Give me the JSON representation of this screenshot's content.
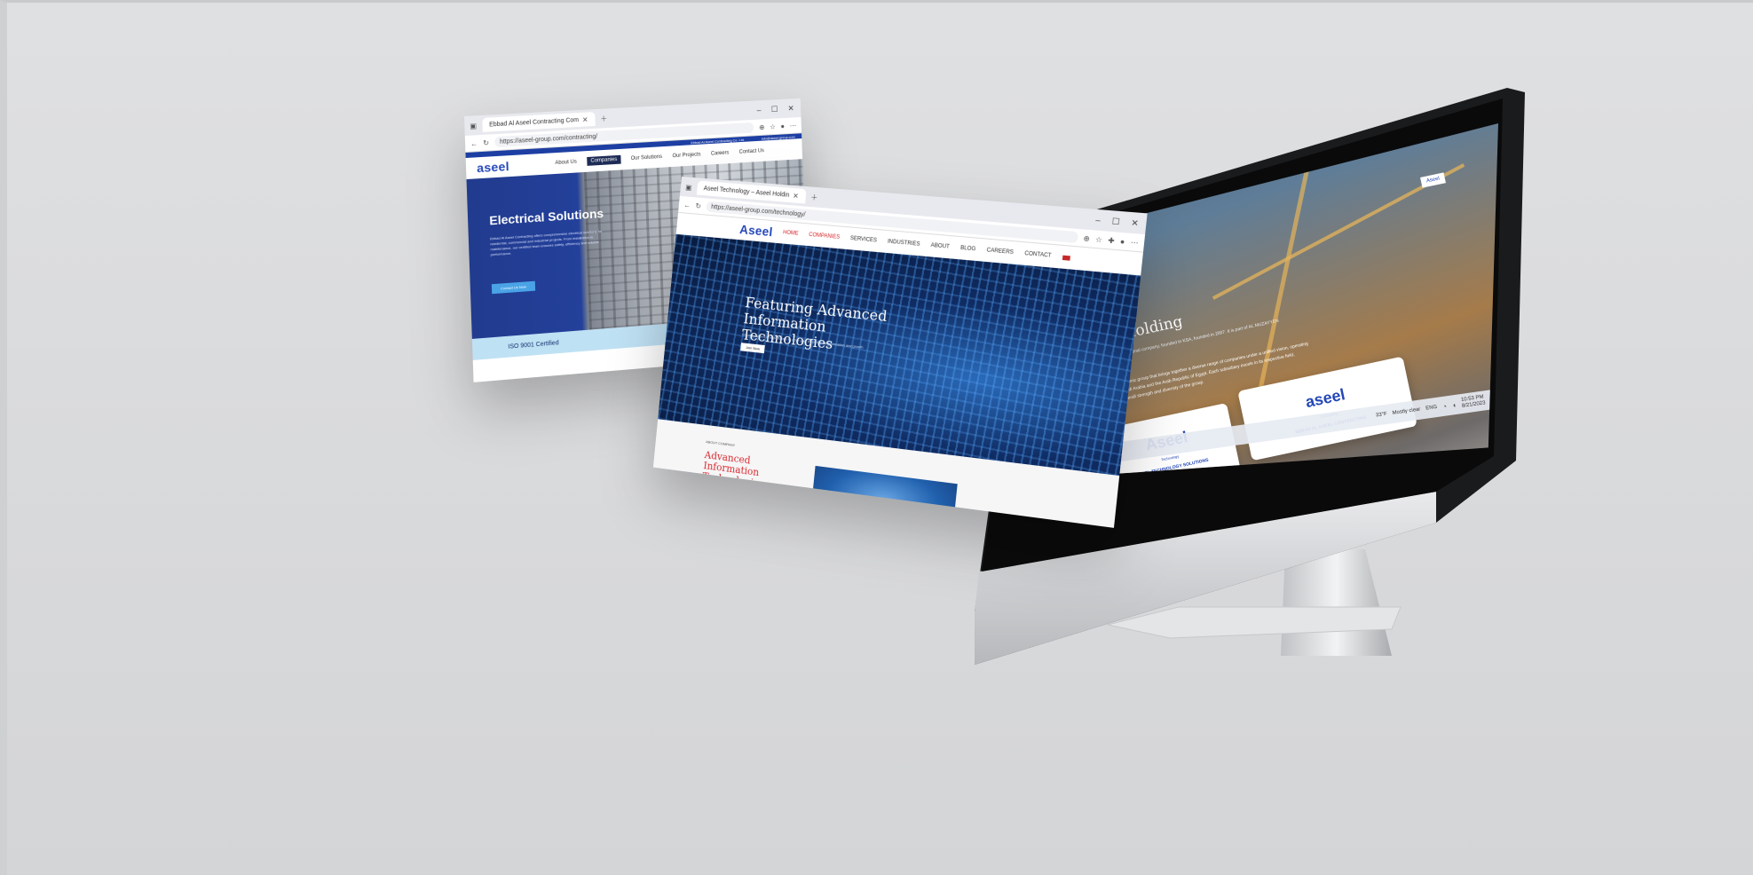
{
  "window_contracting": {
    "tab_title": "Ebbad Al Aseel Contracting Com",
    "url": "https://aseel-group.com/contracting/",
    "top_bar": [
      "Ebbad Al Aseel Contracting Co. Ltd.",
      "info@aseel-group.com"
    ],
    "logo": "aseel",
    "nav": [
      "About Us",
      "Companies",
      "Our Solutions",
      "Our Projects",
      "Careers",
      "Contact Us"
    ],
    "hero_title": "Electrical Solutions",
    "hero_text": "Ebbad Al Aseel Contracting offers comprehensive electrical solutions for residential, commercial and industrial projects. From installation to maintenance, our certified team ensures safety, efficiency and reliable performance.",
    "hero_button": "Contact Us Now",
    "iso_label": "ISO 9001 Certified"
  },
  "window_technology": {
    "tab_title": "Aseel Technology – Aseel Holdin",
    "url": "https://aseel-group.com/technology/",
    "logo": "Aseel",
    "nav": [
      "HOME",
      "COMPANIES",
      "SERVICES",
      "INDUSTRIES",
      "ABOUT",
      "BLOG",
      "CAREERS",
      "CONTACT"
    ],
    "hero_title": "Featuring Advanced Information Technologies",
    "hero_text": "Smart solutions and platforms to drive your business transformation and growth",
    "hero_button": "Join Now",
    "about_eyebrow": "ABOUT COMPANY",
    "about_title": "Advanced Information Technologies"
  },
  "monitor_page": {
    "corner_logo": "Aseel",
    "title": "Aseel Holding",
    "subtitle": "Aseel Holding is a multinational company, founded in KSA, founded in 2007. It is part of AL MUZAYYEN investments Group",
    "paragraph": "Aseel Holding is a dynamic group that brings together a diverse range of companies under a unified vision, operating in the Kingdom of Saudi Arabia and the Arab Republic of Egypt. Each subsidiary excels in its respective field, contributing to the overall strength and diversity of the group.",
    "cards": [
      {
        "logo": "Aseel",
        "tagline": "Technology",
        "caption": "ASEEL TECHNOLOGY SOLUTIONS"
      },
      {
        "logo": "aseel",
        "tagline": "Contracting",
        "caption": "EBBAD AL ASEEL CONTRACTING"
      }
    ],
    "taskbar": {
      "weather_temp": "33°F",
      "weather_text": "Mostly clear",
      "language": "ENG",
      "time": "10:53 PM",
      "date": "8/21/2023"
    }
  }
}
